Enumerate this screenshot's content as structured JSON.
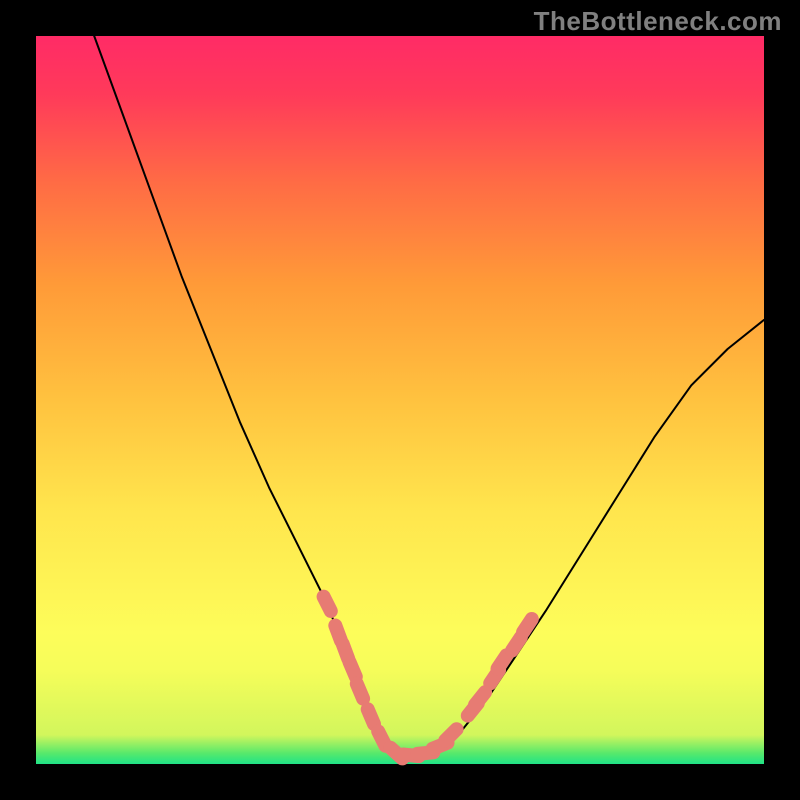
{
  "attribution": "TheBottleneck.com",
  "colors": {
    "frame": "#000000",
    "attribution_text": "#808080",
    "curve": "#000000",
    "marker": "#e77b73",
    "gradient_stops": [
      {
        "pct": 0,
        "hex": "#20e387"
      },
      {
        "pct": 1.5,
        "hex": "#58e96b"
      },
      {
        "pct": 4,
        "hex": "#d2f65c"
      },
      {
        "pct": 13,
        "hex": "#f6fd5a"
      },
      {
        "pct": 18,
        "hex": "#fdfd5a"
      },
      {
        "pct": 35,
        "hex": "#ffe54d"
      },
      {
        "pct": 50,
        "hex": "#ffc23f"
      },
      {
        "pct": 66,
        "hex": "#ff9a38"
      },
      {
        "pct": 80,
        "hex": "#ff6b45"
      },
      {
        "pct": 92,
        "hex": "#ff3a5a"
      },
      {
        "pct": 100,
        "hex": "#ff2b66"
      }
    ]
  },
  "chart_data": {
    "type": "line",
    "title": "",
    "xlabel": "",
    "ylabel": "",
    "xlim": [
      0,
      100
    ],
    "ylim": [
      0,
      100
    ],
    "note": "X and Y are expressed as percentages of the plot area (no visible axis tick labels in source). Curve is a bottleneck V-shape: steep descent from top-left to a flat minimum near x≈47–55, then rising to the right edge.",
    "series": [
      {
        "name": "bottleneck-curve",
        "x": [
          8,
          12,
          16,
          20,
          24,
          28,
          32,
          36,
          40,
          43,
          46,
          48,
          50,
          52,
          54,
          56,
          58,
          62,
          66,
          70,
          75,
          80,
          85,
          90,
          95,
          100
        ],
        "y": [
          100,
          89,
          78,
          67,
          57,
          47,
          38,
          30,
          22,
          14,
          7,
          3,
          1.2,
          1.0,
          1.2,
          2,
          4,
          9,
          15,
          21,
          29,
          37,
          45,
          52,
          57,
          61
        ]
      }
    ],
    "markers": {
      "note": "Salmon dot/segment markers overlaid on the curve near the trough region and partway up both walls.",
      "points_xy": [
        [
          40,
          22
        ],
        [
          41.5,
          18
        ],
        [
          42.5,
          15.5
        ],
        [
          43.5,
          13
        ],
        [
          44.5,
          10
        ],
        [
          46,
          6.5
        ],
        [
          47.5,
          3.5
        ],
        [
          49.5,
          1.5
        ],
        [
          51.5,
          1.2
        ],
        [
          53.5,
          1.5
        ],
        [
          55.5,
          2.5
        ],
        [
          57,
          4
        ],
        [
          60,
          7.5
        ],
        [
          61,
          9
        ],
        [
          63,
          12
        ],
        [
          64,
          14
        ],
        [
          66,
          16.5
        ],
        [
          67.5,
          19
        ]
      ]
    }
  }
}
